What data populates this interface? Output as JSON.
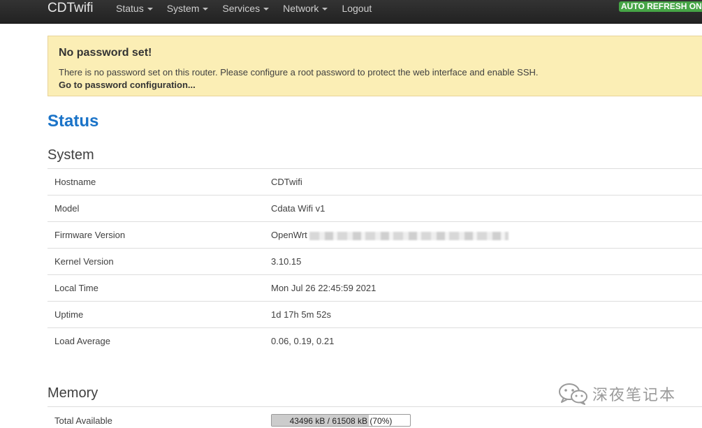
{
  "navbar": {
    "brand": "CDTwifi",
    "items": [
      {
        "label": "Status",
        "dropdown": true
      },
      {
        "label": "System",
        "dropdown": true
      },
      {
        "label": "Services",
        "dropdown": true
      },
      {
        "label": "Network",
        "dropdown": true
      },
      {
        "label": "Logout",
        "dropdown": false
      }
    ],
    "auto_refresh": "AUTO REFRESH ON"
  },
  "alert": {
    "title": "No password set!",
    "text": "There is no password set on this router. Please configure a root password to protect the web interface and enable SSH.",
    "link": "Go to password configuration..."
  },
  "page_title": "Status",
  "system": {
    "title": "System",
    "rows": [
      {
        "label": "Hostname",
        "value": "CDTwifi"
      },
      {
        "label": "Model",
        "value": "Cdata Wifi v1"
      },
      {
        "label": "Firmware Version",
        "value": "OpenWrt"
      },
      {
        "label": "Kernel Version",
        "value": "3.10.15"
      },
      {
        "label": "Local Time",
        "value": "Mon Jul 26 22:45:59 2021"
      },
      {
        "label": "Uptime",
        "value": "1d 17h 5m 52s"
      },
      {
        "label": "Load Average",
        "value": "0.06, 0.19, 0.21"
      }
    ]
  },
  "memory": {
    "title": "Memory",
    "total_available": {
      "label": "Total Available",
      "text": "43496 kB / 61508 kB (70%)",
      "percent": 70
    }
  },
  "watermark": {
    "text": "深夜笔记本",
    "icon": "wechat-icon"
  },
  "colors": {
    "navbar": "#222222",
    "alert_bg": "#fbeeb5",
    "title_blue": "#1a73c8",
    "auto_refresh_green": "#46a546"
  }
}
